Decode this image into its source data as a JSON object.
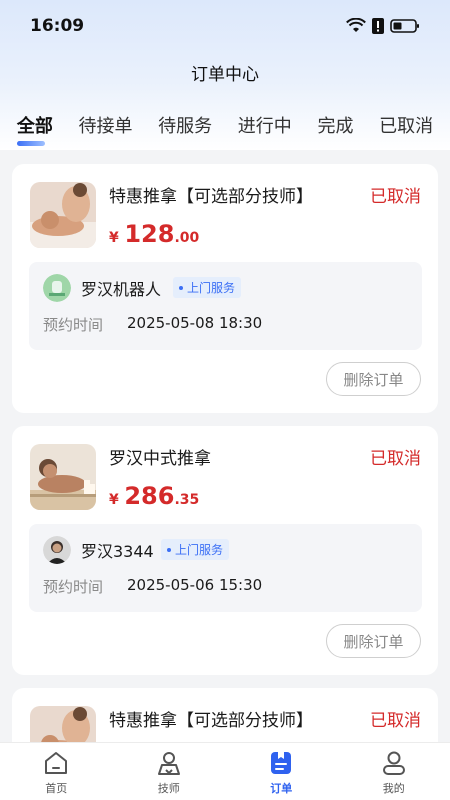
{
  "status_bar": {
    "time": "16:09"
  },
  "header": {
    "title": "订单中心"
  },
  "tabs": [
    {
      "label": "全部",
      "active": true
    },
    {
      "label": "待接单",
      "active": false
    },
    {
      "label": "待服务",
      "active": false
    },
    {
      "label": "进行中",
      "active": false
    },
    {
      "label": "完成",
      "active": false
    },
    {
      "label": "已取消",
      "active": false
    }
  ],
  "orders": [
    {
      "product_name": "特惠推拿【可选部分技师】",
      "status": "已取消",
      "price_currency": "¥",
      "price_int": "128",
      "price_dec": ".00",
      "technician": "罗汉机器人",
      "service_badge": "上门服务",
      "appointment_label": "预约时间",
      "appointment_time": "2025-05-08 18:30",
      "delete_label": "删除订单"
    },
    {
      "product_name": "罗汉中式推拿",
      "status": "已取消",
      "price_currency": "¥",
      "price_int": "286",
      "price_dec": ".35",
      "technician": "罗汉3344",
      "service_badge": "上门服务",
      "appointment_label": "预约时间",
      "appointment_time": "2025-05-06 15:30",
      "delete_label": "删除订单"
    },
    {
      "product_name": "特惠推拿【可选部分技师】",
      "status": "已取消"
    }
  ],
  "bottom_nav": [
    {
      "label": "首页",
      "icon": "home-icon",
      "active": false
    },
    {
      "label": "技师",
      "icon": "technician-icon",
      "active": false
    },
    {
      "label": "订单",
      "icon": "order-icon",
      "active": true
    },
    {
      "label": "我的",
      "icon": "profile-icon",
      "active": false
    }
  ],
  "colors": {
    "accent": "#2f62ef",
    "cancel_red": "#d42a2a",
    "price_red": "#d42a2a"
  }
}
